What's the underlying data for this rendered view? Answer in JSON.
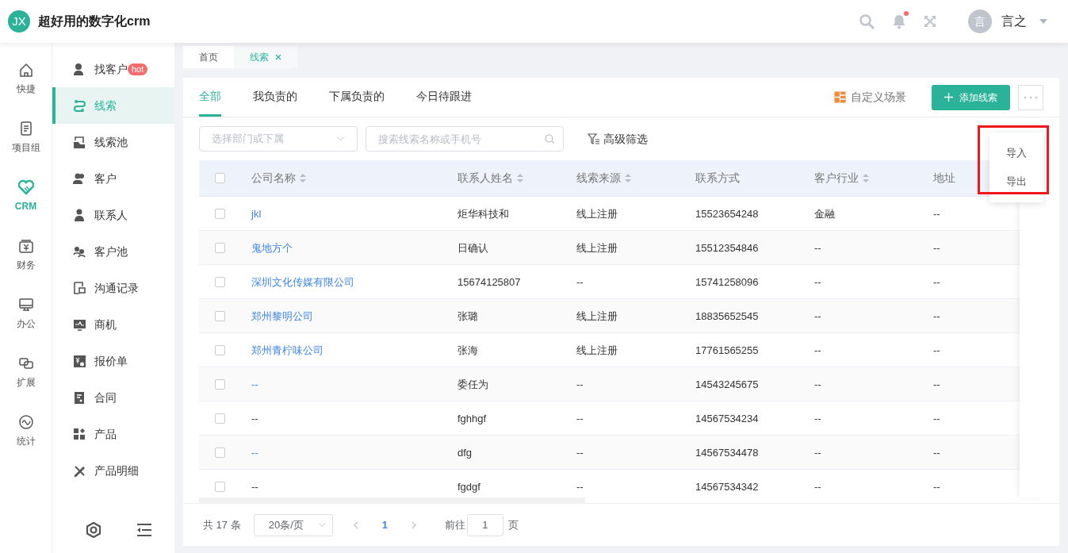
{
  "header": {
    "logo": "JX",
    "title": "超好用的数字化crm",
    "notification_dot": true,
    "user": {
      "avatar": "言",
      "name": "言之"
    }
  },
  "rail": [
    {
      "label": "快捷",
      "selected": false
    },
    {
      "label": "项目组",
      "selected": false
    },
    {
      "label": "CRM",
      "selected": true
    },
    {
      "label": "财务",
      "selected": false
    },
    {
      "label": "办公",
      "selected": false
    },
    {
      "label": "扩展",
      "selected": false
    },
    {
      "label": "统计",
      "selected": false
    }
  ],
  "sidebar": {
    "items": [
      {
        "label": "找客户",
        "badge": "hot",
        "selected": false
      },
      {
        "label": "线索",
        "selected": true
      },
      {
        "label": "线索池",
        "selected": false
      },
      {
        "label": "客户",
        "selected": false
      },
      {
        "label": "联系人",
        "selected": false
      },
      {
        "label": "客户池",
        "selected": false
      },
      {
        "label": "沟通记录",
        "selected": false
      },
      {
        "label": "商机",
        "selected": false
      },
      {
        "label": "报价单",
        "selected": false
      },
      {
        "label": "合同",
        "selected": false
      },
      {
        "label": "产品",
        "selected": false
      },
      {
        "label": "产品明细",
        "selected": false
      }
    ]
  },
  "page_tabs": [
    {
      "label": "首页",
      "selected": false,
      "closable": false
    },
    {
      "label": "线索",
      "selected": true,
      "closable": true
    }
  ],
  "scene_tabs": [
    {
      "label": "全部",
      "selected": true
    },
    {
      "label": "我负责的",
      "selected": false
    },
    {
      "label": "下属负责的",
      "selected": false
    },
    {
      "label": "今日待跟进",
      "selected": false
    }
  ],
  "custom_scene": "自定义场景",
  "add_button": "添加线索",
  "more_menu": {
    "highlighted": true,
    "items": [
      "导入",
      "导出"
    ]
  },
  "filters": {
    "department": {
      "placeholder": "选择部门或下属"
    },
    "search": {
      "placeholder": "搜索线索名称或手机号"
    },
    "advanced": "高级筛选"
  },
  "table": {
    "select_all_checked": false,
    "columns": [
      {
        "label": "公司名称",
        "sortable": true
      },
      {
        "label": "联系人姓名",
        "sortable": true
      },
      {
        "label": "线索来源",
        "sortable": true
      },
      {
        "label": "联系方式",
        "sortable": false
      },
      {
        "label": "客户行业",
        "sortable": true
      },
      {
        "label": "地址",
        "sortable": false
      }
    ],
    "rows": [
      {
        "checked": false,
        "link": true,
        "cells": [
          "jkl",
          "炬华科技和",
          "线上注册",
          "15523654248",
          "金融",
          "--"
        ]
      },
      {
        "checked": false,
        "link": true,
        "cells": [
          "鬼地方个",
          "日确认",
          "线上注册",
          "15512354846",
          "--",
          "--"
        ]
      },
      {
        "checked": false,
        "link": true,
        "cells": [
          "深圳文化传媒有限公司",
          "15674125807",
          "--",
          "15741258096",
          "--",
          "--"
        ]
      },
      {
        "checked": false,
        "link": true,
        "cells": [
          "郑州黎明公司",
          "张璐",
          "线上注册",
          "18835652545",
          "--",
          "--"
        ]
      },
      {
        "checked": false,
        "link": true,
        "cells": [
          "郑州青柠味公司",
          "张海",
          "线上注册",
          "17761565255",
          "--",
          "--"
        ]
      },
      {
        "checked": false,
        "link": true,
        "cells": [
          "--",
          "委任为",
          "--",
          "14543245675",
          "--",
          "--"
        ]
      },
      {
        "checked": false,
        "link": false,
        "cells": [
          "--",
          "fghhgf",
          "--",
          "14567534234",
          "--",
          "--"
        ]
      },
      {
        "checked": false,
        "link": true,
        "cells": [
          "--",
          "dfg",
          "--",
          "14567534478",
          "--",
          "--"
        ]
      },
      {
        "checked": false,
        "link": false,
        "cells": [
          "--",
          "fgdgf",
          "--",
          "14567534342",
          "--",
          "--"
        ]
      }
    ]
  },
  "pagination": {
    "total": "共 17 条",
    "page_size": "20条/页",
    "pages": [
      {
        "label": "1",
        "selected": true
      }
    ],
    "goto_label": "前往",
    "goto_value": "1",
    "page_suffix": "页"
  }
}
